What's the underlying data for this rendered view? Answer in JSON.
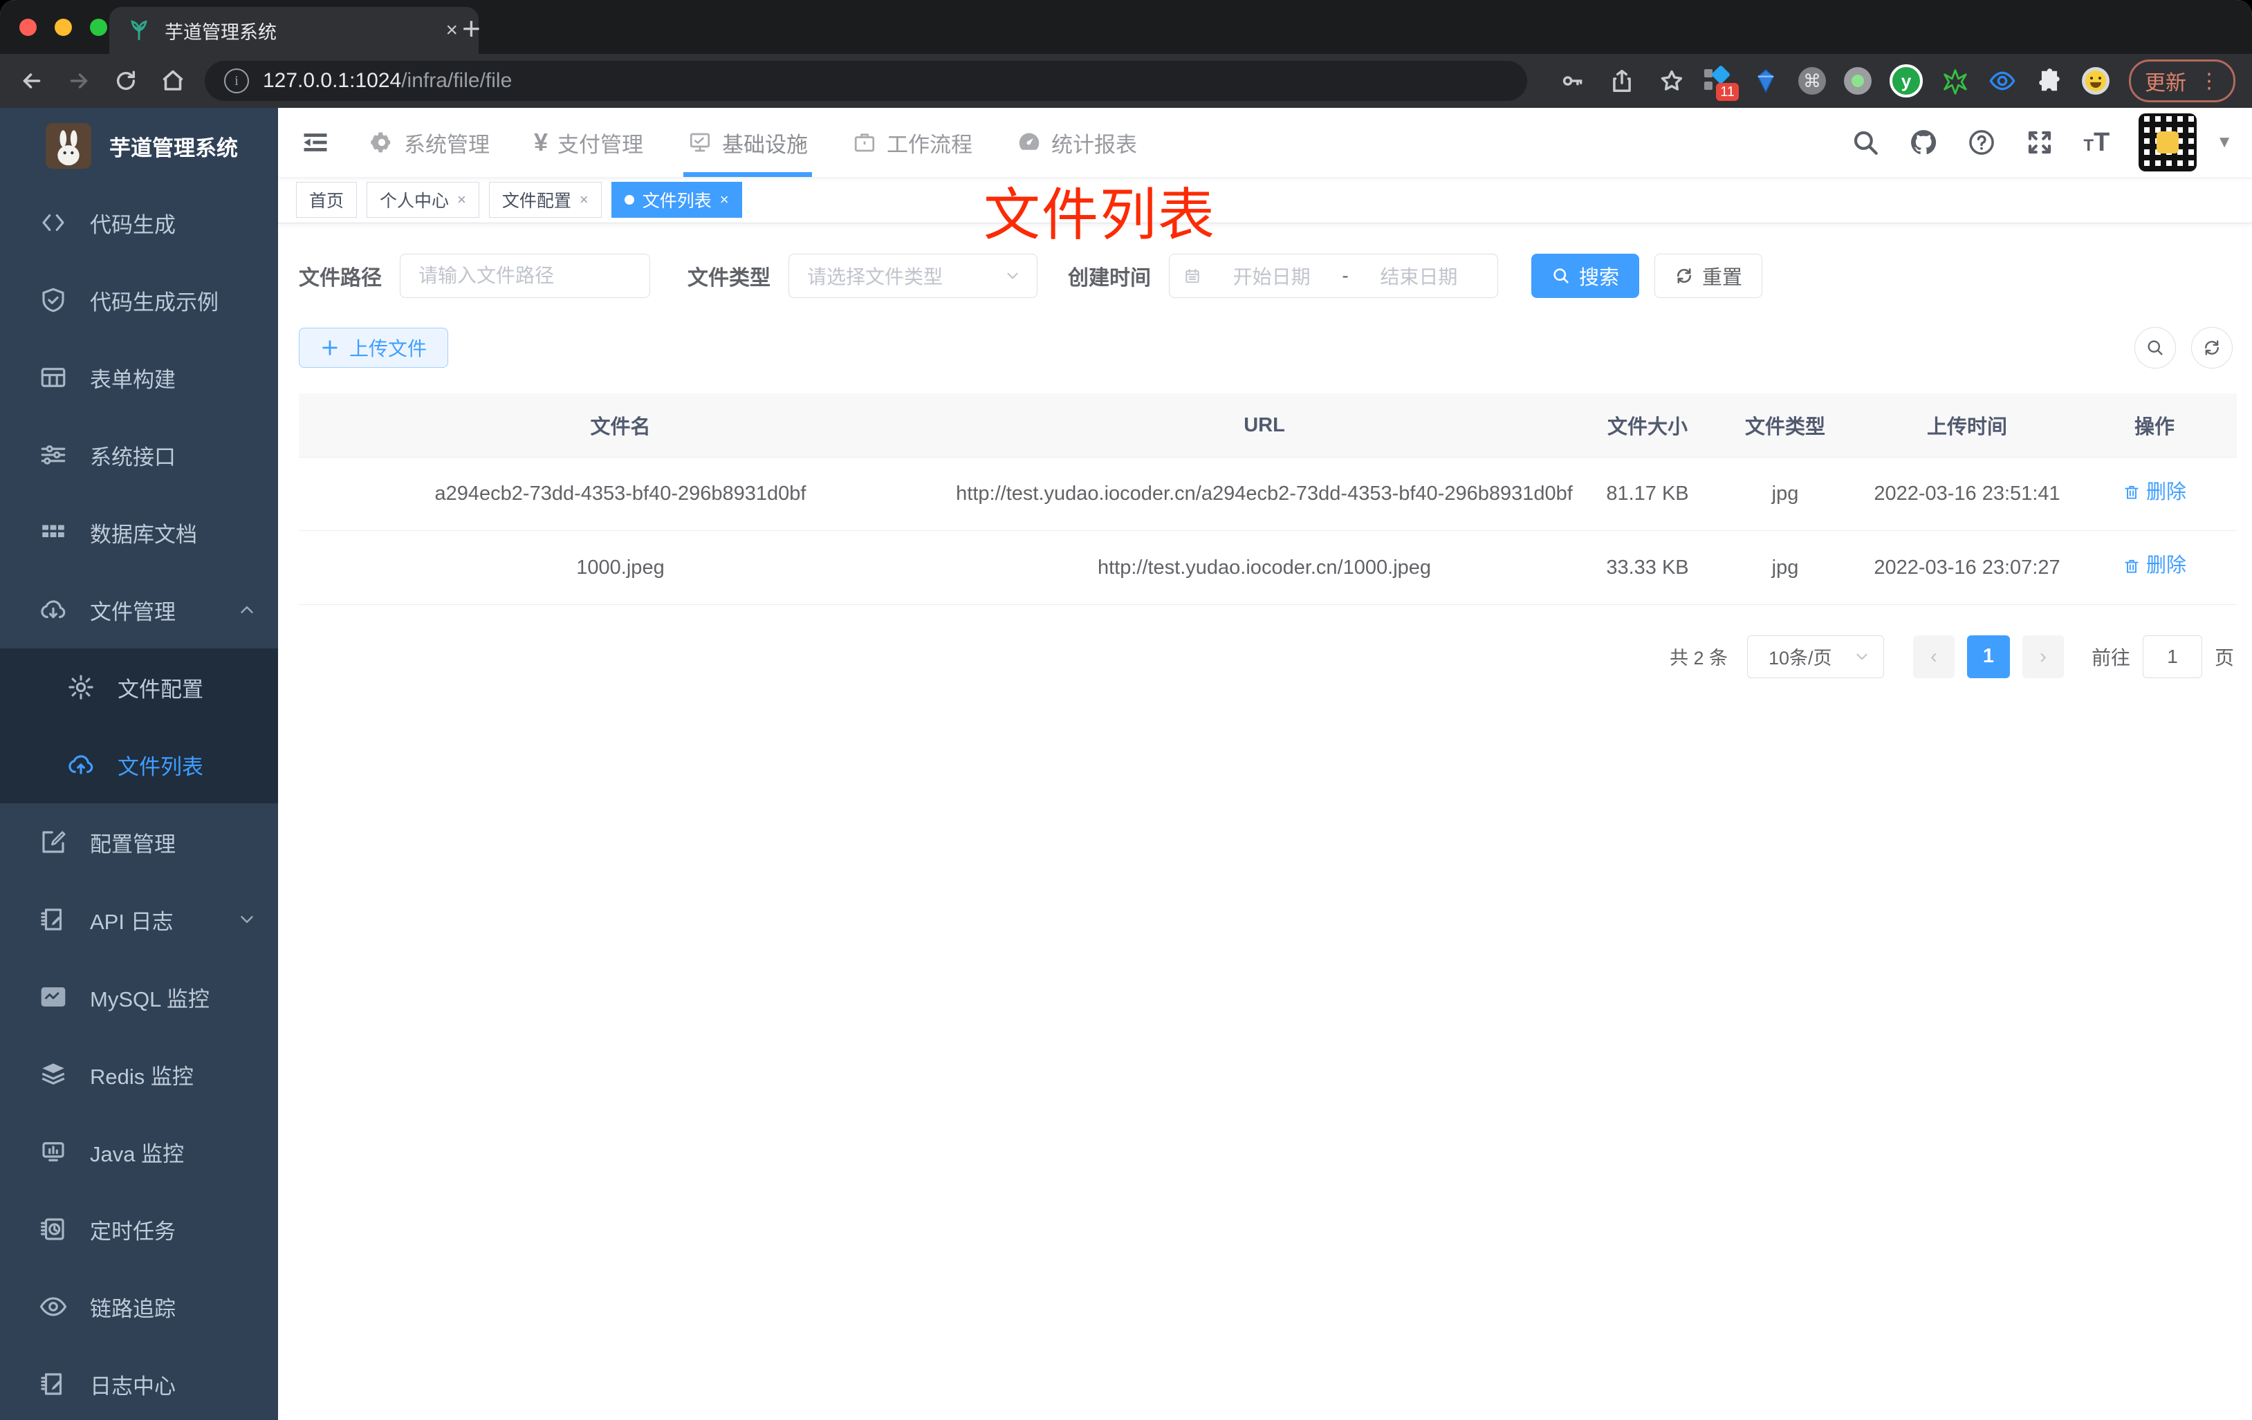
{
  "browser": {
    "tab": {
      "title": "芋道管理系统",
      "close_glyph": "×",
      "new_tab_glyph": "+"
    },
    "url": {
      "host": "127.0.0.1:1024",
      "path": "/infra/file/file"
    },
    "toolbar": {
      "update_label": "更新",
      "extension_badge": "11",
      "menu_glyph": "⋮"
    }
  },
  "colors": {
    "accent": "#409eff",
    "annotation": "#fb2b05",
    "sidebar_bg": "#304156",
    "submenu_bg": "#1f2d3d"
  },
  "sidebar": {
    "title": "芋道管理系统",
    "items": [
      {
        "label": "代码生成"
      },
      {
        "label": "代码生成示例"
      },
      {
        "label": "表单构建"
      },
      {
        "label": "系统接口"
      },
      {
        "label": "数据库文档"
      },
      {
        "label": "文件管理"
      },
      {
        "label": "文件配置"
      },
      {
        "label": "文件列表"
      },
      {
        "label": "配置管理"
      },
      {
        "label": "API 日志"
      },
      {
        "label": "MySQL 监控"
      },
      {
        "label": "Redis 监控"
      },
      {
        "label": "Java 监控"
      },
      {
        "label": "定时任务"
      },
      {
        "label": "链路追踪"
      },
      {
        "label": "日志中心"
      }
    ]
  },
  "topnav": {
    "items": [
      {
        "label": "系统管理"
      },
      {
        "label": "支付管理"
      },
      {
        "label": "基础设施"
      },
      {
        "label": "工作流程"
      },
      {
        "label": "统计报表"
      }
    ]
  },
  "tags": {
    "items": [
      {
        "label": "首页"
      },
      {
        "label": "个人中心"
      },
      {
        "label": "文件配置"
      },
      {
        "label": "文件列表"
      }
    ],
    "close_glyph": "×"
  },
  "annotation": {
    "text": "文件列表"
  },
  "filters": {
    "path_label": "文件路径",
    "path_placeholder": "请输入文件路径",
    "type_label": "文件类型",
    "type_placeholder": "请选择文件类型",
    "date_label": "创建时间",
    "date_start_placeholder": "开始日期",
    "date_separator": "-",
    "date_end_placeholder": "结束日期",
    "search_label": "搜索",
    "reset_label": "重置",
    "upload_label": "上传文件"
  },
  "table": {
    "headers": [
      "文件名",
      "URL",
      "文件大小",
      "文件类型",
      "上传时间",
      "操作"
    ],
    "rows": [
      {
        "name": "a294ecb2-73dd-4353-bf40-296b8931d0bf",
        "url": "http://test.yudao.iocoder.cn/a294ecb2-73dd-4353-bf40-296b8931d0bf",
        "size": "81.17 KB",
        "type": "jpg",
        "time": "2022-03-16 23:51:41",
        "action": "删除"
      },
      {
        "name": "1000.jpeg",
        "url": "http://test.yudao.iocoder.cn/1000.jpeg",
        "size": "33.33 KB",
        "type": "jpg",
        "time": "2022-03-16 23:07:27",
        "action": "删除"
      }
    ]
  },
  "pagination": {
    "total": "共 2 条",
    "page_size": "10条/页",
    "prev_glyph": "‹",
    "current_page": "1",
    "next_glyph": "›",
    "goto_label": "前往",
    "goto_value": "1",
    "page_unit": "页"
  }
}
